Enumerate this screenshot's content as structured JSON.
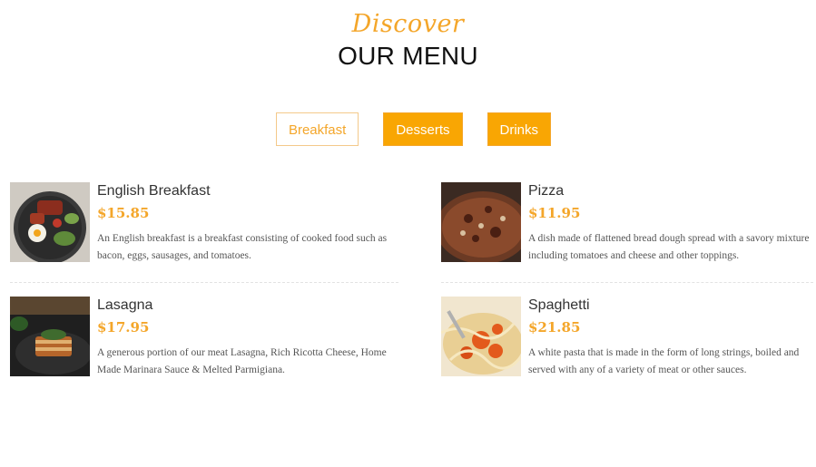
{
  "header": {
    "kicker": "Discover",
    "title": "OUR MENU"
  },
  "tabs": [
    {
      "label": "Breakfast",
      "active": true
    },
    {
      "label": "Desserts",
      "active": false
    },
    {
      "label": "Drinks",
      "active": false
    }
  ],
  "colors": {
    "accent": "#f9a603",
    "price": "#f4a62a"
  },
  "menu_items": [
    {
      "name": "English Breakfast",
      "price": "$15.85",
      "description": "An English breakfast is a breakfast consisting of cooked food such as bacon, eggs, sausages, and tomatoes."
    },
    {
      "name": "Pizza",
      "price": "$11.95",
      "description": "A dish made of flattened bread dough spread with a savory mixture including tomatoes and cheese and other toppings."
    },
    {
      "name": "Lasagna",
      "price": "$17.95",
      "description": "A generous portion of our meat Lasagna, Rich Ricotta Cheese, Home Made Marinara Sauce & Melted Parmigiana."
    },
    {
      "name": "Spaghetti",
      "price": "$21.85",
      "description": "A white pasta that is made in the form of long strings, boiled and served with any of a variety of meat or other sauces."
    }
  ]
}
